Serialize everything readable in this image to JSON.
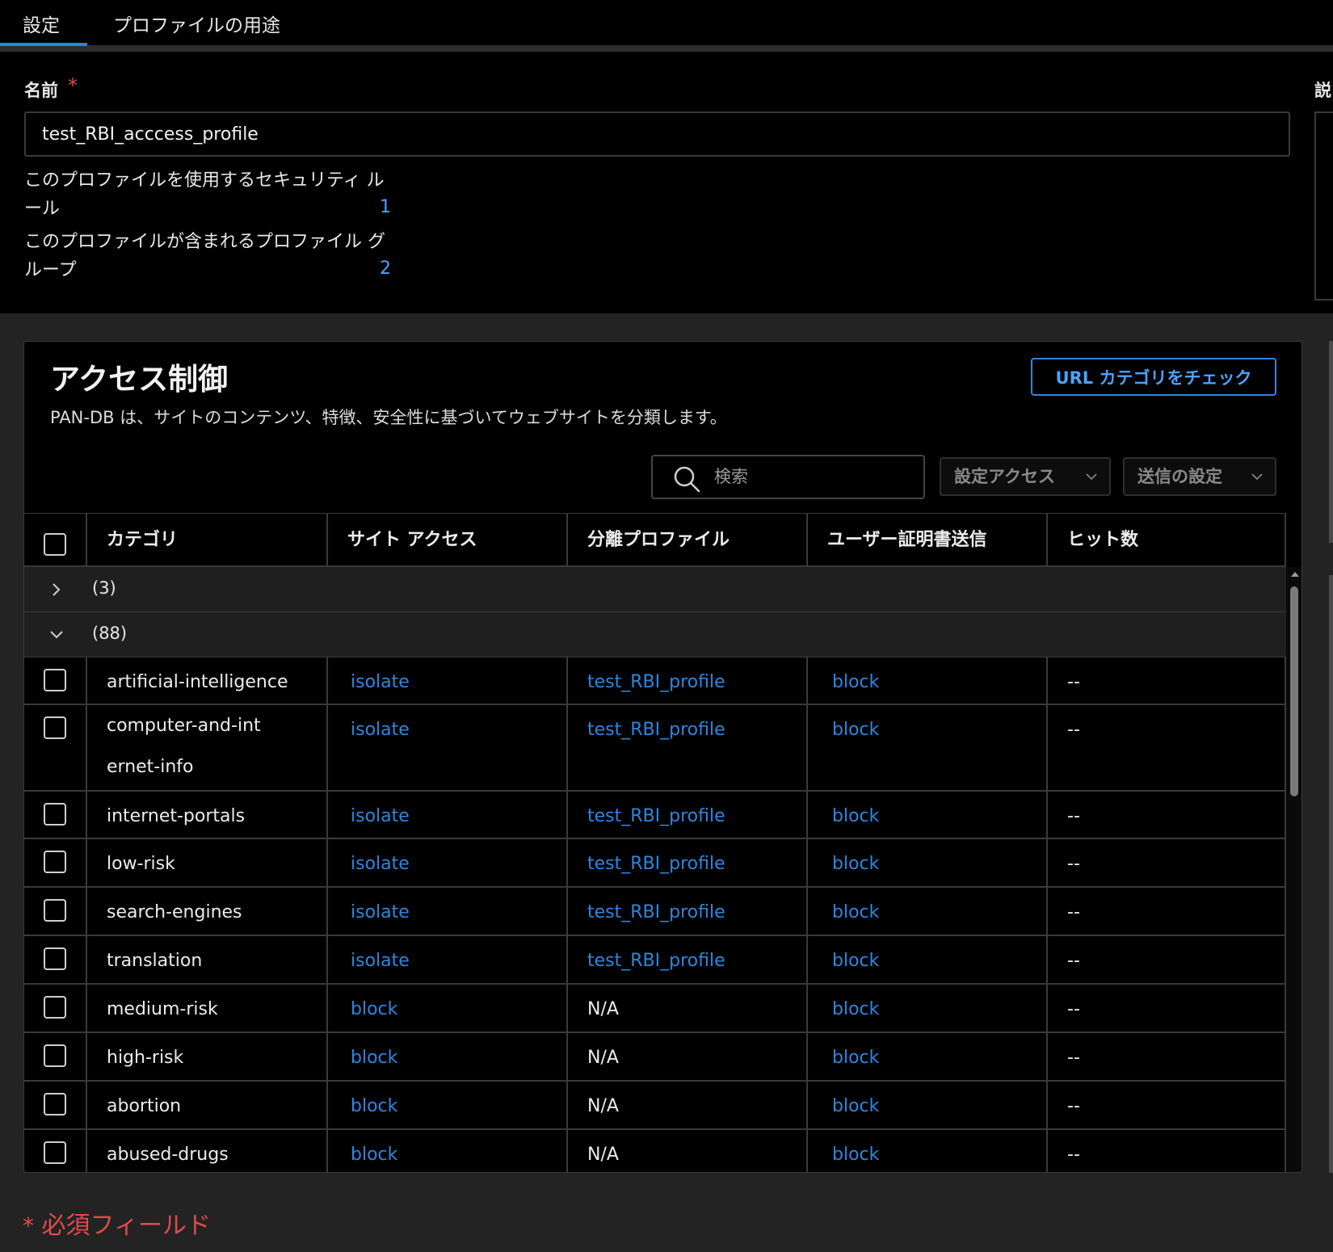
{
  "tabs": [
    {
      "label": "設定"
    },
    {
      "label": "プロファイルの用途"
    }
  ],
  "general": {
    "name_label": "名前",
    "required_marker": "*",
    "name_value": "test_RBI_acccess_profile",
    "side_label": "説",
    "security_rules_label": "このプロファイルを使用するセキュリティ ルール",
    "security_rules_count": "1",
    "profile_groups_label": "このプロファイルが含まれるプロファイル グループ",
    "profile_groups_count": "2"
  },
  "access_control": {
    "title": "アクセス制御",
    "description": "PAN-DB は、サイトのコンテンツ、特徴、安全性に基づいてウェブサイトを分類します。",
    "url_check_button": "URL カテゴリをチェック",
    "search_placeholder": "検索",
    "set_access_dropdown": "設定アクセス",
    "send_settings_dropdown": "送信の設定",
    "columns": [
      "カテゴリ",
      "サイト アクセス",
      "分離プロファイル",
      "ユーザー証明書送信",
      "ヒット数"
    ],
    "groups": [
      {
        "label": "(3)",
        "expanded": false
      },
      {
        "label": "(88)",
        "expanded": true
      }
    ],
    "rows": [
      {
        "category": "artificial-intelligence",
        "site_access": "isolate",
        "isolation_profile": "test_RBI_profile",
        "user_cred": "block",
        "hits": "--"
      },
      {
        "category": "computer-and-internet-info",
        "site_access": "isolate",
        "isolation_profile": "test_RBI_profile",
        "user_cred": "block",
        "hits": "--"
      },
      {
        "category": "internet-portals",
        "site_access": "isolate",
        "isolation_profile": "test_RBI_profile",
        "user_cred": "block",
        "hits": "--"
      },
      {
        "category": "low-risk",
        "site_access": "isolate",
        "isolation_profile": "test_RBI_profile",
        "user_cred": "block",
        "hits": "--"
      },
      {
        "category": "search-engines",
        "site_access": "isolate",
        "isolation_profile": "test_RBI_profile",
        "user_cred": "block",
        "hits": "--"
      },
      {
        "category": "translation",
        "site_access": "isolate",
        "isolation_profile": "test_RBI_profile",
        "user_cred": "block",
        "hits": "--"
      },
      {
        "category": "medium-risk",
        "site_access": "block",
        "isolation_profile": "N/A",
        "user_cred": "block",
        "hits": "--"
      },
      {
        "category": "high-risk",
        "site_access": "block",
        "isolation_profile": "N/A",
        "user_cred": "block",
        "hits": "--"
      },
      {
        "category": "abortion",
        "site_access": "block",
        "isolation_profile": "N/A",
        "user_cred": "block",
        "hits": "--"
      },
      {
        "category": "abused-drugs",
        "site_access": "block",
        "isolation_profile": "N/A",
        "user_cred": "block",
        "hits": "--"
      }
    ]
  },
  "footer": {
    "required_marker": "*",
    "required_note": "必須フィールド"
  },
  "colors": {
    "accent": "#1e88e5",
    "link": "#2f86de",
    "required": "#e24a4a",
    "background": "#000000"
  }
}
